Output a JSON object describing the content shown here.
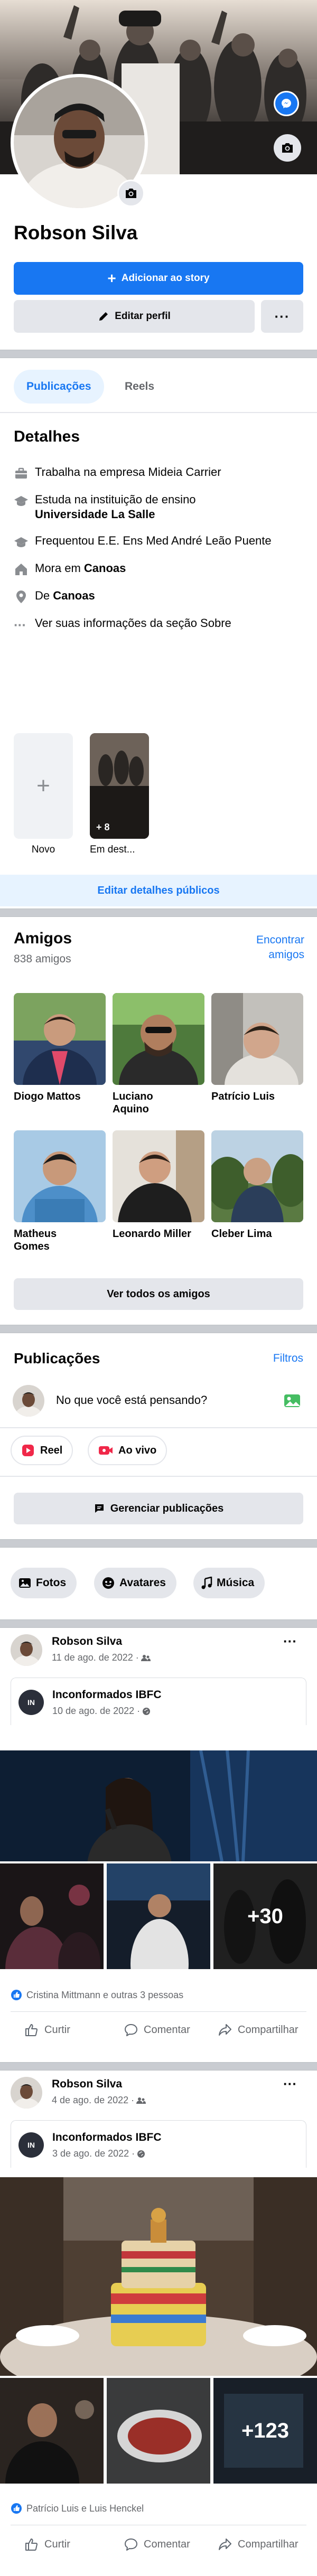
{
  "profile": {
    "name": "Robson Silva",
    "add_story": "Adicionar ao story",
    "edit_profile": "Editar perfil",
    "more": "···"
  },
  "tabs": {
    "posts": "Publicações",
    "reels": "Reels"
  },
  "details": {
    "title": "Detalhes",
    "work": "Trabalha na empresa Mideia Carrier",
    "study_prefix": "Estuda na instituição de ensino",
    "study_school": "Universidade La Salle",
    "highschool": "Frequentou E.E. Ens Med André Leão Puente",
    "lives_prefix": "Mora em ",
    "lives_city": "Canoas",
    "from_prefix": "De ",
    "from_city": "Canoas",
    "about": "Ver suas informações da seção Sobre",
    "feat_new": "Novo",
    "feat_album": "Em dest...",
    "feat_count": "+ 8",
    "edit_public": "Editar detalhes públicos"
  },
  "friends": {
    "title": "Amigos",
    "count": "838 amigos",
    "find": "Encontrar amigos",
    "list": [
      {
        "name": "Diogo Mattos"
      },
      {
        "name": "Luciano Aquino"
      },
      {
        "name": "Patrício Luis"
      },
      {
        "name": "Matheus Gomes"
      },
      {
        "name": "Leonardo Miller"
      },
      {
        "name": "Cleber Lima"
      }
    ],
    "see_all": "Ver todos os amigos"
  },
  "composer": {
    "title": "Publicações",
    "filters": "Filtros",
    "placeholder": "No que você está pensando?",
    "reel": "Reel",
    "live": "Ao vivo",
    "manage": "Gerenciar publicações"
  },
  "media_tabs": {
    "photos": "Fotos",
    "avatars": "Avatares",
    "music": "Música"
  },
  "posts": [
    {
      "author": "Robson Silva",
      "date": "11 de ago. de 2022 ·",
      "shared_author": "Inconformados IBFC",
      "shared_date": "10 de ago. de 2022 ·",
      "more_photos": "+30",
      "reactions": "Cristina Mittmann e outras 3 pessoas"
    },
    {
      "author": "Robson Silva",
      "date": "4 de ago. de 2022 ·",
      "shared_author": "Inconformados IBFC",
      "shared_date": "3 de ago. de 2022 ·",
      "more_photos": "+123",
      "reactions": "Patrício Luis e Luis Henckel"
    }
  ],
  "post_actions": {
    "like": "Curtir",
    "comment": "Comentar",
    "share": "Compartilhar"
  },
  "colors": {
    "accent": "#1877f2",
    "separator": "#c9ccd1",
    "button_gray": "#e4e6eb",
    "text_secondary": "#65676b"
  }
}
